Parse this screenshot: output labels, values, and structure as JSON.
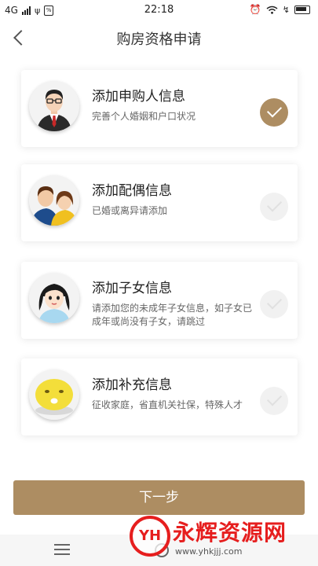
{
  "status_bar": {
    "network": "4G",
    "time": "22:18",
    "icons": [
      "signal-icon",
      "usb-icon",
      "app-notification-icon",
      "alarm-icon",
      "wifi-icon",
      "charging-icon",
      "battery-icon"
    ]
  },
  "header": {
    "title": "购房资格申请",
    "back_icon": "chevron-left-icon"
  },
  "cards": [
    {
      "title": "添加申购人信息",
      "desc": "完善个人婚姻和户口状况",
      "avatar": "businessman-avatar",
      "checked": true
    },
    {
      "title": "添加配偶信息",
      "desc": "已婚或离异请添加",
      "avatar": "couple-avatar",
      "checked": false
    },
    {
      "title": "添加子女信息",
      "desc": "请添加您的未成年子女信息，如子女已成年或尚没有子女，请跳过",
      "avatar": "girl-avatar",
      "checked": false
    },
    {
      "title": "添加补充信息",
      "desc": "征收家庭，省直机关社保，特殊人才",
      "avatar": "smiley-avatar",
      "checked": false
    }
  ],
  "next_button": {
    "label": "下一步"
  },
  "nav_bar": {
    "icons": [
      "menu-icon",
      "home-icon"
    ]
  },
  "watermark": {
    "logo": "YH",
    "text": "永辉资源网",
    "url": "www.yhkjjj.com"
  },
  "colors": {
    "accent": "#ad8d62",
    "check_off": "#f1f1f1",
    "watermark_red": "#e61e1e"
  }
}
